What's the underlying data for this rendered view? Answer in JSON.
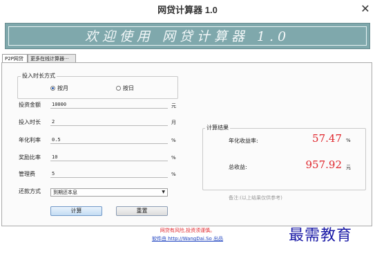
{
  "window": {
    "title": "网贷计算器 1.0",
    "close_glyph": "✕"
  },
  "banner": {
    "text": "欢迎使用 网贷计算器 1.0"
  },
  "tabs": [
    {
      "label": "P2P网贷"
    },
    {
      "label": "更多在线计算器···"
    }
  ],
  "form": {
    "duration_mode": {
      "title": "投入时长方式",
      "options": [
        {
          "label": "按月",
          "selected": true
        },
        {
          "label": "按日",
          "selected": false
        }
      ]
    },
    "amount": {
      "label": "投资金额",
      "value": "10000",
      "unit": "元"
    },
    "duration": {
      "label": "投入时长",
      "value": "2",
      "unit": "月"
    },
    "annual_rate": {
      "label": "年化利率",
      "value": "0.5",
      "unit": "%"
    },
    "reward_rate": {
      "label": "奖励比率",
      "value": "10",
      "unit": "%"
    },
    "management_fee": {
      "label": "管理费",
      "value": "5",
      "unit": "%"
    },
    "repayment": {
      "label": "还款方式",
      "selected": "到期还本息"
    },
    "calculate_label": "计算",
    "reset_label": "重置"
  },
  "results": {
    "title": "计算结果",
    "annual_yield": {
      "label": "年化收益率:",
      "value": "57.47",
      "unit": "%"
    },
    "total_income": {
      "label": "总收益:",
      "value": "957.92",
      "unit": "元"
    },
    "note": "备注:(以上结果仅供参考)"
  },
  "footer": {
    "warning": "网贷有风险,投资须谨慎。",
    "credit": "软件由 http://WangDai.So 出品"
  },
  "watermark": "最需教育",
  "colors": {
    "accent_red": "#e0262c",
    "banner": "#7fa8ac",
    "link_blue": "#1a3fbf"
  }
}
